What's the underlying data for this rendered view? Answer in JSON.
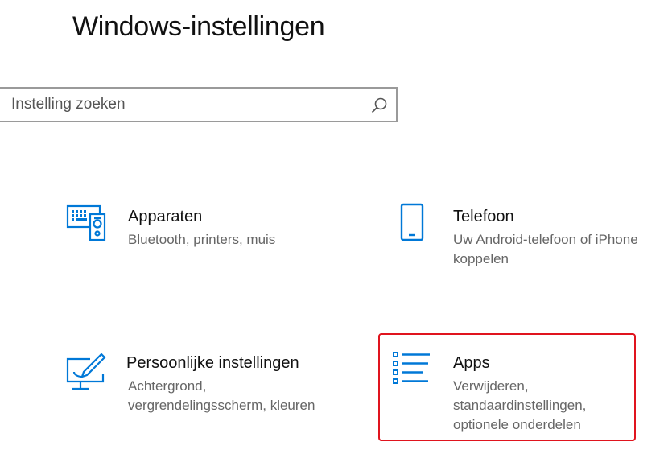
{
  "page": {
    "title": "Windows-instellingen"
  },
  "search": {
    "placeholder": "Instelling zoeken",
    "icon": "search-icon"
  },
  "tiles": [
    {
      "name": "Apparaten",
      "desc": [
        "Bluetooth, printers, muis"
      ],
      "icon": "devices-icon"
    },
    {
      "name": "Telefoon",
      "desc": [
        "Uw Android-telefoon of iPhone",
        "koppelen"
      ],
      "icon": "phone-icon"
    },
    {
      "name": "Persoonlijke instellingen",
      "desc": [
        "Achtergrond,",
        "vergrendelingsscherm, kleuren"
      ],
      "icon": "personalization-icon"
    },
    {
      "name": "Apps",
      "desc": [
        "Verwijderen,",
        "standaardinstellingen,",
        "optionele onderdelen"
      ],
      "icon": "apps-icon",
      "highlighted": true
    }
  ],
  "colors": {
    "accent": "#0078d7",
    "highlight": "#e0141e"
  }
}
